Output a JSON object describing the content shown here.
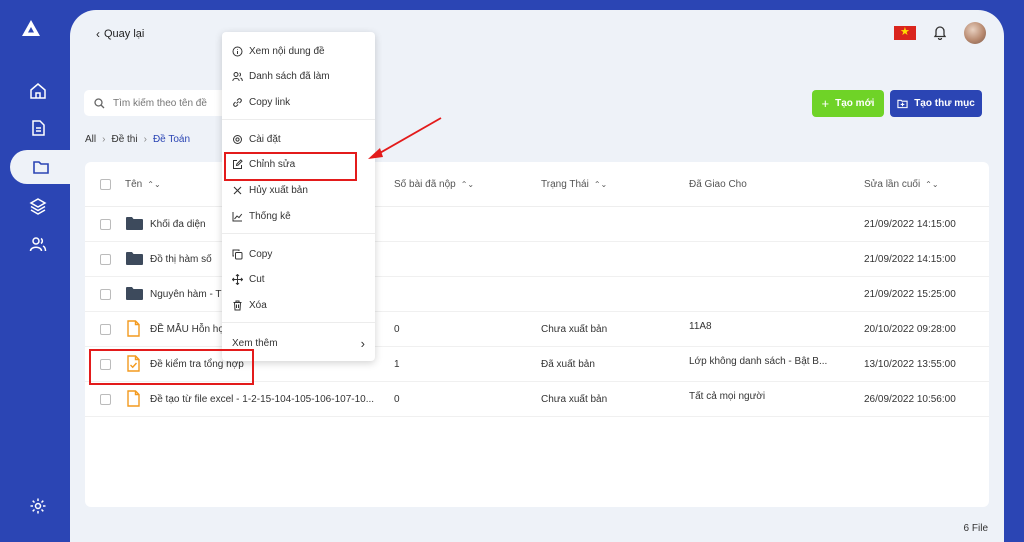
{
  "back_label": "Quay lại",
  "search": {
    "placeholder": "Tìm kiếm theo tên đề"
  },
  "buttons": {
    "new": "Tạo mới",
    "new_folder": "Tạo thư mục"
  },
  "breadcrumb": [
    "All",
    "Đề thi",
    "Đề Toán"
  ],
  "table": {
    "headers": [
      "Tên",
      "Số bài đã nộp",
      "Trạng Thái",
      "Đã Giao Cho",
      "Sửa lần cuối"
    ],
    "rows": [
      {
        "type": "folder",
        "name": "Khối đa diện",
        "submitted": "",
        "status": "",
        "assigned": "",
        "modified": "21/09/2022 14:15:00"
      },
      {
        "type": "folder",
        "name": "Đồ thị hàm số",
        "submitted": "",
        "status": "",
        "assigned": "",
        "modified": "21/09/2022 14:15:00"
      },
      {
        "type": "folder",
        "name": "Nguyên hàm - Tí",
        "submitted": "",
        "status": "",
        "assigned": "",
        "modified": "21/09/2022 15:25:00"
      },
      {
        "type": "file",
        "name": "ĐỀ MẪU Hỗn hợp",
        "submitted": "0",
        "status": "Chưa xuất bản",
        "assigned": "11A8",
        "modified": "20/10/2022 09:28:00"
      },
      {
        "type": "file-check",
        "name": "Đề kiểm tra tổng hợp",
        "submitted": "1",
        "status": "Đã xuất bản",
        "assigned": "Lớp không danh sách - Bật B...",
        "modified": "13/10/2022 13:55:00"
      },
      {
        "type": "file",
        "name": "Đề tạo từ file excel - 1-2-15-104-105-106-107-10...",
        "submitted": "0",
        "status": "Chưa xuất bản",
        "assigned": "Tất cả mọi người",
        "modified": "26/09/2022 10:56:00"
      }
    ]
  },
  "file_count": "6 File",
  "context_menu": {
    "items": [
      {
        "label": "Xem nội dung đề",
        "icon": "info-icon"
      },
      {
        "label": "Danh sách đã làm",
        "icon": "users-icon"
      },
      {
        "label": "Copy link",
        "icon": "link-icon"
      },
      {
        "label": "Cài đặt",
        "icon": "gear-icon"
      },
      {
        "label": "Chỉnh sửa",
        "icon": "edit-icon"
      },
      {
        "label": "Hủy xuất bản",
        "icon": "close-icon"
      },
      {
        "label": "Thống kê",
        "icon": "chart-icon"
      },
      {
        "label": "Copy",
        "icon": "copy-icon"
      },
      {
        "label": "Cut",
        "icon": "move-icon"
      },
      {
        "label": "Xóa",
        "icon": "trash-icon"
      },
      {
        "label": "Xem thêm",
        "icon": "chevron-right-icon"
      }
    ]
  },
  "colors": {
    "brand": "#2b45b4",
    "accent_green": "#6fd327",
    "folder": "#3d4a5c",
    "file": "#f39a1e",
    "highlight": "#e31b1b"
  }
}
